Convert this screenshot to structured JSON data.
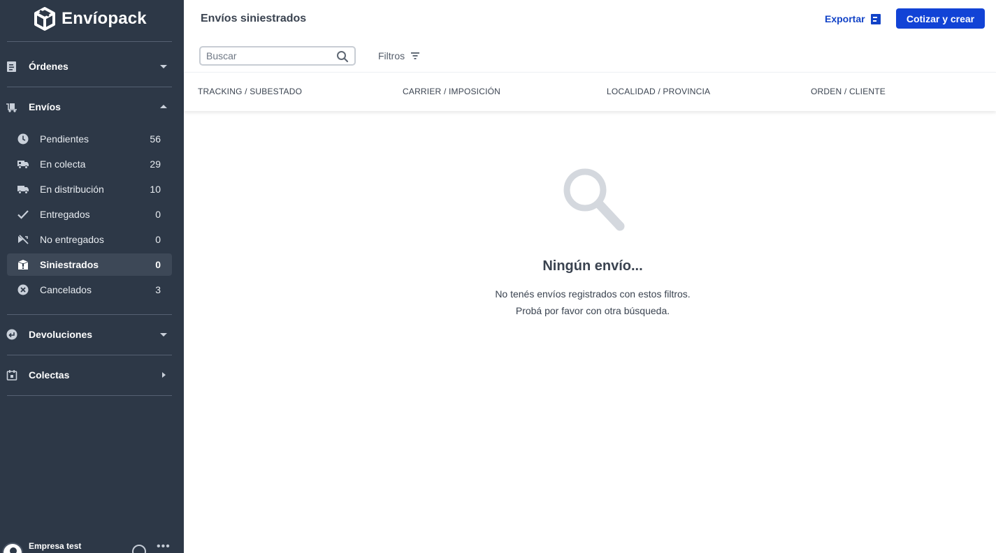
{
  "brand": {
    "name": "Envíopack"
  },
  "sidebar": {
    "sections": [
      {
        "label": "Órdenes",
        "icon": "document-icon",
        "state": "collapsed"
      },
      {
        "label": "Envíos",
        "icon": "shipment-cart-icon",
        "state": "expanded"
      },
      {
        "label": "Devoluciones",
        "icon": "return-icon",
        "state": "collapsed"
      },
      {
        "label": "Colectas",
        "icon": "calendar-icon",
        "state": "closed"
      }
    ],
    "envios_items": [
      {
        "label": "Pendientes",
        "count": "56",
        "icon": "clock-icon"
      },
      {
        "label": "En colecta",
        "count": "29",
        "icon": "pickup-truck-icon"
      },
      {
        "label": "En distribución",
        "count": "10",
        "icon": "delivery-truck-icon"
      },
      {
        "label": "Entregados",
        "count": "0",
        "icon": "check-icon"
      },
      {
        "label": "No entregados",
        "count": "0",
        "icon": "not-delivered-icon"
      },
      {
        "label": "Siniestrados",
        "count": "0",
        "icon": "damaged-box-icon",
        "active": true
      },
      {
        "label": "Cancelados",
        "count": "3",
        "icon": "cancel-circle-icon"
      }
    ],
    "user": {
      "company": "Empresa test"
    }
  },
  "header": {
    "title": "Envíos siniestrados",
    "export_label": "Exportar",
    "create_label": "Cotizar y crear"
  },
  "search": {
    "placeholder": "Buscar",
    "value": ""
  },
  "filters": {
    "label": "Filtros"
  },
  "table": {
    "columns": [
      "TRACKING / SUBESTADO",
      "CARRIER / IMPOSICIÓN",
      "LOCALIDAD / PROVINCIA",
      "ORDEN / CLIENTE"
    ]
  },
  "empty_state": {
    "title": "Ningún envío...",
    "line1": "No tenés envíos registrados con estos filtros.",
    "line2": "Probá por favor con otra búsqueda."
  },
  "colors": {
    "sidebar_bg": "#2d3847",
    "active_item_bg": "#3d4857",
    "primary": "#1243d6",
    "link": "#1243c7"
  }
}
